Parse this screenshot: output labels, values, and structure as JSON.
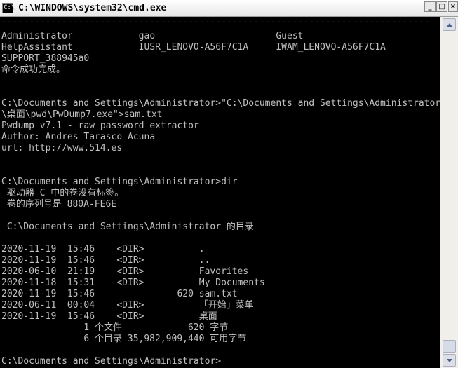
{
  "window": {
    "title": "C:\\WINDOWS\\system32\\cmd.exe",
    "controls": {
      "minimize": "_",
      "maximize": "□",
      "close": "×"
    }
  },
  "console": {
    "lines": [
      "------------------------------------------------------------------------------",
      "Administrator            gao                      Guest",
      "HelpAssistant            IUSR_LENOVO-A56F7C1A     IWAM_LENOVO-A56F7C1A",
      "SUPPORT_388945a0",
      "命令成功完成。",
      "",
      "",
      "C:\\Documents and Settings\\Administrator>\"C:\\Documents and Settings\\Administrator",
      "\\桌面\\pwd\\PwDump7.exe\">sam.txt",
      "Pwdump v7.1 - raw password extractor",
      "Author: Andres Tarasco Acuna",
      "url: http://www.514.es",
      "",
      "",
      "C:\\Documents and Settings\\Administrator>dir",
      " 驱动器 C 中的卷没有标签。",
      " 卷的序列号是 880A-FE6E",
      "",
      " C:\\Documents and Settings\\Administrator 的目录",
      "",
      "2020-11-19  15:46    <DIR>          .",
      "2020-11-19  15:46    <DIR>          ..",
      "2020-06-10  21:19    <DIR>          Favorites",
      "2020-11-18  15:31    <DIR>          My Documents",
      "2020-11-19  15:46               620 sam.txt",
      "2020-06-11  00:04    <DIR>          「开始」菜单",
      "2020-11-19  15:46    <DIR>          桌面",
      "               1 个文件            620 字节",
      "               6 个目录 35,982,909,440 可用字节",
      "",
      "C:\\Documents and Settings\\Administrator>"
    ]
  }
}
